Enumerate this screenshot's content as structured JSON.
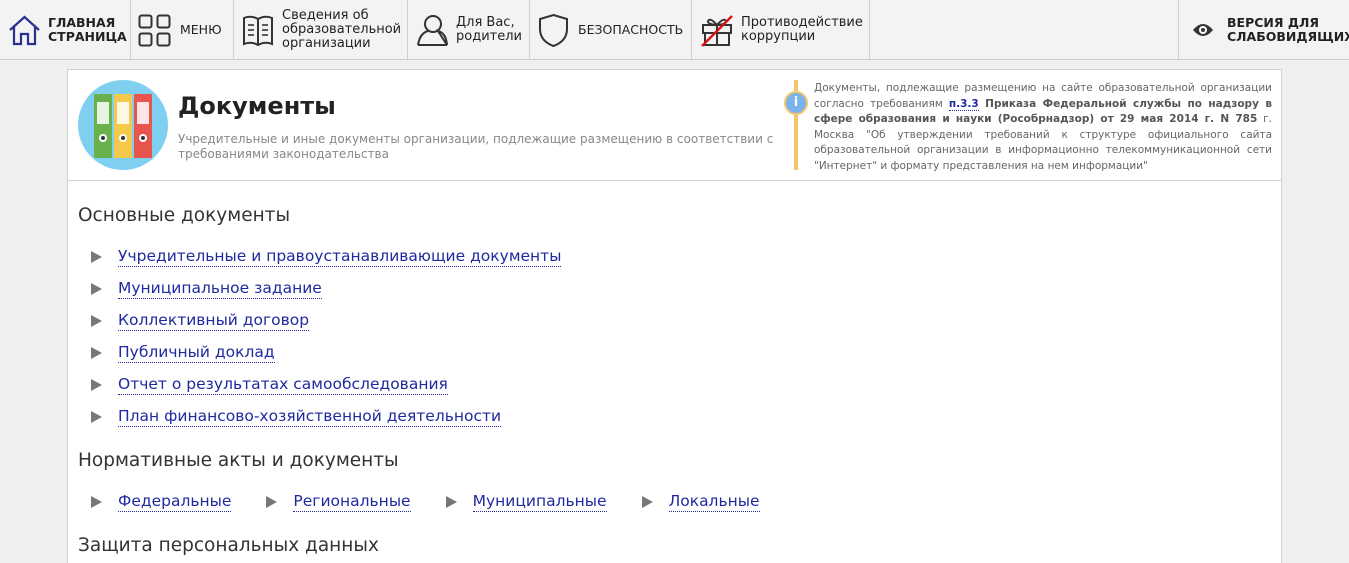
{
  "nav": {
    "home": {
      "line1": "ГЛАВНАЯ",
      "line2": "СТРАНИЦА",
      "icon": "home-icon"
    },
    "menu": {
      "label": "МЕНЮ",
      "icon": "grid-icon"
    },
    "info": {
      "line1": "Сведения об",
      "line2": "образовательной",
      "line3": "организации",
      "icon": "book-icon"
    },
    "parents": {
      "line1": "Для Вас,",
      "line2": "родители",
      "icon": "person-icon"
    },
    "security": {
      "label": "БЕЗОПАСНОСТЬ",
      "icon": "shield-icon"
    },
    "corruption": {
      "line1": "Противодействие",
      "line2": "коррупции",
      "icon": "crossed-gift-icon"
    },
    "vision": {
      "line1": "ВЕРСИЯ ДЛЯ",
      "line2": "СЛАБОВИДЯЩИХ",
      "icon": "eye-icon"
    }
  },
  "header": {
    "title": "Документы",
    "subtitle": "Учредительные и иные документы организации, подлежащие размещению в соответствии с требованиями законодательства",
    "note": {
      "part1": "Документы, подлежащие размещению на сайте образовательной организации согласно требованиям ",
      "link": "п.3.3",
      "bold": " Приказа Федеральной службы по надзору в сфере образования и науки (Рособрнадзор) от 29 мая 2014 г. N 785",
      "part2": " г. Москва \"Об утверждении требований к структуре официального сайта образовательной организации в информационно телекоммуникационной сети \"Интернет\" и формату представления на нем информации\""
    }
  },
  "sections": {
    "main_docs": {
      "title": "Основные документы",
      "items": [
        "Учредительные и правоустанавливающие документы",
        "Муниципальное задание",
        "Коллективный договор",
        "Публичный доклад",
        "Отчет о результатах самообследования",
        "План финансово-хозяйственной деятельности"
      ]
    },
    "normative": {
      "title": "Нормативные акты и документы",
      "items": [
        "Федеральные",
        "Региональные",
        "Муниципальные",
        "Локальные"
      ]
    },
    "personal": {
      "title": "Защита персональных данных"
    }
  },
  "colors": {
    "link": "#1f2aa0",
    "note_accent": "#f5c66a",
    "info_icon": "#7ab2ee"
  }
}
